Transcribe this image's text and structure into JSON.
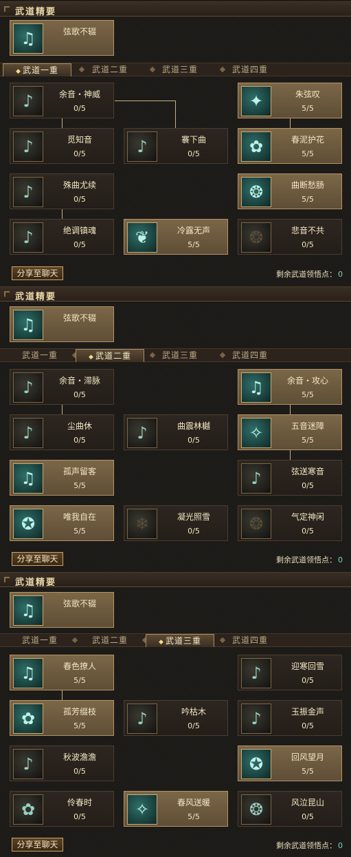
{
  "sections": [
    {
      "header_title": "武道精要",
      "featured": {
        "name": "弦歌不辍",
        "icon": "lute-icon"
      },
      "tabs": [
        "武道一重",
        "武道二重",
        "武道三重",
        "武道四重"
      ],
      "active_tab": 0,
      "skills": [
        {
          "name": "余音・神威",
          "count": "0/5",
          "state": "locked"
        },
        {
          "name": "朱弦叹",
          "count": "5/5",
          "state": "learned"
        },
        {
          "name": "觅知音",
          "count": "0/5",
          "state": "locked"
        },
        {
          "name": "褰下曲",
          "count": "0/5",
          "state": "locked"
        },
        {
          "name": "春泥护花",
          "count": "5/5",
          "state": "learned"
        },
        {
          "name": "殊曲尤续",
          "count": "0/5",
          "state": "locked"
        },
        {
          "name": "曲断愁肠",
          "count": "5/5",
          "state": "learned"
        },
        {
          "name": "绝调镇魂",
          "count": "0/5",
          "state": "locked"
        },
        {
          "name": "冷露无声",
          "count": "5/5",
          "state": "learned"
        },
        {
          "name": "悲音不共",
          "count": "0/5",
          "state": "locked"
        }
      ],
      "share_label": "分享至聊天",
      "remaining_label": "剩余武道领悟点：",
      "remaining_value": "0"
    },
    {
      "header_title": "武道精要",
      "featured": {
        "name": "弦歌不辍",
        "icon": "lute-icon"
      },
      "tabs": [
        "武道一重",
        "武道二重",
        "武道三重",
        "武道四重"
      ],
      "active_tab": 1,
      "skills": [
        {
          "name": "余音・滞脉",
          "count": "0/5",
          "state": "locked"
        },
        {
          "name": "余音・攻心",
          "count": "5/5",
          "state": "learned"
        },
        {
          "name": "尘曲休",
          "count": "0/5",
          "state": "locked"
        },
        {
          "name": "曲震林樾",
          "count": "0/5",
          "state": "locked"
        },
        {
          "name": "五音迷障",
          "count": "5/5",
          "state": "learned"
        },
        {
          "name": "孤声留客",
          "count": "5/5",
          "state": "learned"
        },
        {
          "name": "弦送寒音",
          "count": "0/5",
          "state": "locked"
        },
        {
          "name": "唯我自在",
          "count": "5/5",
          "state": "learned"
        },
        {
          "name": "凝光照雪",
          "count": "0/5",
          "state": "locked"
        },
        {
          "name": "气定神闲",
          "count": "0/5",
          "state": "locked"
        }
      ],
      "share_label": "分享至聊天",
      "remaining_label": "剩余武道领悟点：",
      "remaining_value": "0"
    },
    {
      "header_title": "武道精要",
      "featured": {
        "name": "弦歌不辍",
        "icon": "lute-icon"
      },
      "tabs": [
        "武道一重",
        "武道二重",
        "武道三重",
        "武道四重"
      ],
      "active_tab": 2,
      "skills": [
        {
          "name": "春色撩人",
          "count": "5/5",
          "state": "learned"
        },
        {
          "name": "迎寒回雪",
          "count": "0/5",
          "state": "locked"
        },
        {
          "name": "孤芳缀枝",
          "count": "5/5",
          "state": "learned"
        },
        {
          "name": "吟枯木",
          "count": "0/5",
          "state": "locked"
        },
        {
          "name": "玉振金声",
          "count": "0/5",
          "state": "locked"
        },
        {
          "name": "秋波澹澹",
          "count": "0/5",
          "state": "locked"
        },
        {
          "name": "回风望月",
          "count": "5/5",
          "state": "learned"
        },
        {
          "name": "伶春时",
          "count": "0/5",
          "state": "locked"
        },
        {
          "name": "春风送暖",
          "count": "5/5",
          "state": "learned"
        },
        {
          "name": "风泣昆山",
          "count": "0/5",
          "state": "locked"
        }
      ],
      "share_label": "分享至聊天",
      "remaining_label": "剩余武道领悟点：",
      "remaining_value": "0"
    }
  ],
  "colors": {
    "accent": "#c9a56b",
    "learned_bg": "#6b5a3e",
    "count_highlight": "#7ad2c9"
  }
}
